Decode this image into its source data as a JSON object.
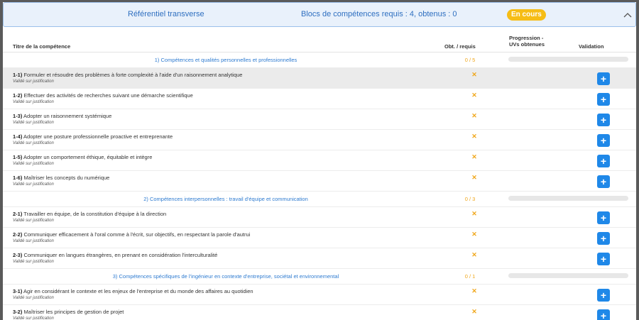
{
  "header": {
    "title": "Référentiel transverse",
    "blocks": "Blocs de compétences requis : 4, obtenus : 0",
    "status": "En cours"
  },
  "columns": {
    "title": "Titre de la compétence",
    "obt": "Obt. / requis",
    "prog_line1": "Progression -",
    "prog_line2": "UVs obtenues",
    "valid": "Validation"
  },
  "sections": [
    {
      "num": "1)",
      "label": "Compétences et qualités personnelles et professionnelles",
      "score": "0 / 5",
      "progress": 0,
      "items": [
        {
          "code": "1-1)",
          "text": "Formuler et résoudre des problèmes à forte complexité à l'aide d'un raisonnement analytique",
          "sub": "Validé sur justification",
          "obt": "✕",
          "highlight": true
        },
        {
          "code": "1-2)",
          "text": "Effectuer des activités de recherches suivant une démarche scientifique",
          "sub": "Validé sur justification",
          "obt": "✕"
        },
        {
          "code": "1-3)",
          "text": "Adopter un raisonnement systémique",
          "sub": "Validé sur justification",
          "obt": "✕"
        },
        {
          "code": "1-4)",
          "text": "Adopter une posture professionnelle proactive et entreprenante",
          "sub": "Validé sur justification",
          "obt": "✕"
        },
        {
          "code": "1-5)",
          "text": "Adopter un comportement éthique, équitable et intègre",
          "sub": "Validé sur justification",
          "obt": "✕"
        },
        {
          "code": "1-6)",
          "text": "Maîtriser les concepts du numérique",
          "sub": "Validé sur justification",
          "obt": "✕"
        }
      ]
    },
    {
      "num": "2)",
      "label": "Compétences interpersonnelles : travail d'équipe et communication",
      "score": "0 / 3",
      "progress": 0,
      "items": [
        {
          "code": "2-1)",
          "text": "Travailler en équipe, de la constitution d'équipe à la direction",
          "sub": "Validé sur justification",
          "obt": "✕"
        },
        {
          "code": "2-2)",
          "text": "Communiquer efficacement à l'oral comme à l'écrit, sur objectifs, en respectant la parole d'autrui",
          "sub": "Validé sur justification",
          "obt": "✕"
        },
        {
          "code": "2-3)",
          "text": "Communiquer en langues étrangères, en prenant en considération l'interculturalité",
          "sub": "Validé sur justification",
          "obt": "✕"
        }
      ]
    },
    {
      "num": "3)",
      "label": "Compétences spécifiques de l'ingénieur en contexte d'entreprise, sociétal et environnemental",
      "score": "0 / 1",
      "progress": 0,
      "items": [
        {
          "code": "3-1)",
          "text": "Agir en considérant le contexte et les enjeux de l'entreprise et du monde des affaires au quotidien",
          "sub": "Validé sur justification",
          "obt": "✕"
        },
        {
          "code": "3-2)",
          "text": "Maîtriser les principes de gestion de projet",
          "sub": "Validé sur justification",
          "obt": "✕"
        }
      ]
    }
  ],
  "icons": {
    "collapse": "chevron-up-icon",
    "validate": "plus-icon"
  },
  "colors": {
    "accent": "#1f88e8",
    "status": "#f6bd16",
    "header_bg": "#e9f1fb"
  }
}
